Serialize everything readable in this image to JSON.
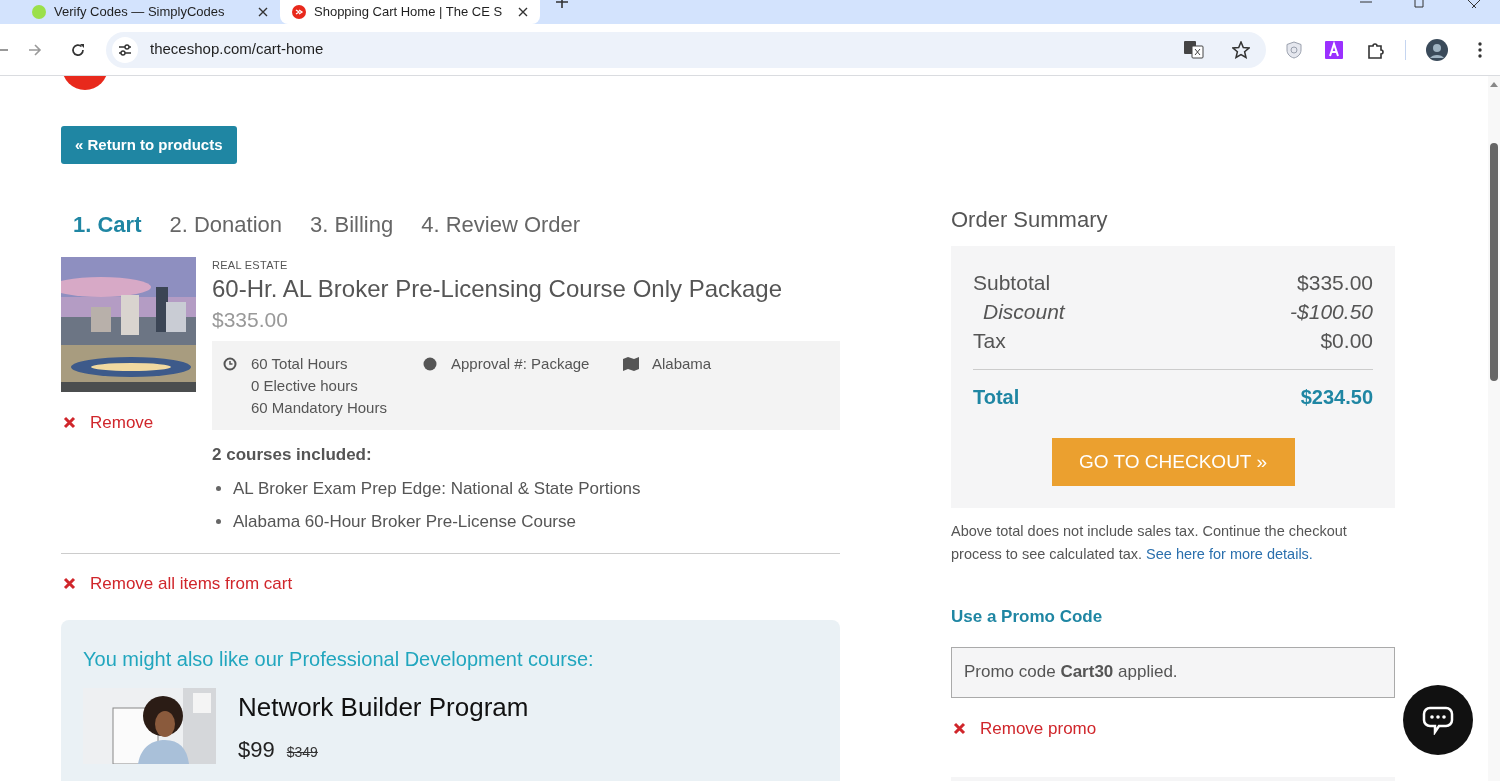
{
  "browser": {
    "tabs": [
      {
        "title": "Verify Codes — SimplyCodes",
        "selected": false
      },
      {
        "title": "Shopping Cart Home | The CE S",
        "selected": true
      }
    ],
    "url": "theceshop.com/cart-home"
  },
  "return_button": "« Return to products",
  "steps": [
    {
      "label": "1. Cart",
      "selected": true
    },
    {
      "label": "2. Donation",
      "selected": false
    },
    {
      "label": "3. Billing",
      "selected": false
    },
    {
      "label": "4. Review Order",
      "selected": false
    }
  ],
  "cart_item": {
    "category": "REAL ESTATE",
    "title": "60-Hr. AL Broker Pre-Licensing Course Only Package",
    "price": "$335.00",
    "hours": [
      "60 Total Hours",
      "0 Elective hours",
      "60 Mandatory Hours"
    ],
    "approval": "Approval #: Package",
    "state": "Alabama",
    "remove": "Remove",
    "included_heading": "2 courses included:",
    "included_courses": [
      "AL Broker Exam Prep Edge: National & State Portions",
      "Alabama 60-Hour Broker Pre-License Course"
    ]
  },
  "remove_all": "Remove all items from cart",
  "recommendation": {
    "heading": "You might also like our Professional Development course:",
    "title": "Network Builder Program",
    "price": "$99",
    "original_price": "$349"
  },
  "order_summary": {
    "title": "Order Summary",
    "lines": [
      {
        "label": "Subtotal",
        "value": "$335.00",
        "kind": "normal"
      },
      {
        "label": "Discount",
        "value": "-$100.50",
        "kind": "discount"
      },
      {
        "label": "Tax",
        "value": "$0.00",
        "kind": "normal"
      }
    ],
    "total_label": "Total",
    "total_value": "$234.50",
    "checkout_button": "GO TO CHECKOUT »"
  },
  "tax_note": {
    "text": "Above total does not include sales tax. Continue the checkout process to see calculated tax.",
    "link": "See here for more details."
  },
  "promo": {
    "heading": "Use a Promo Code",
    "message": "Promo code **Cart30** applied.",
    "remove": "Remove promo"
  }
}
